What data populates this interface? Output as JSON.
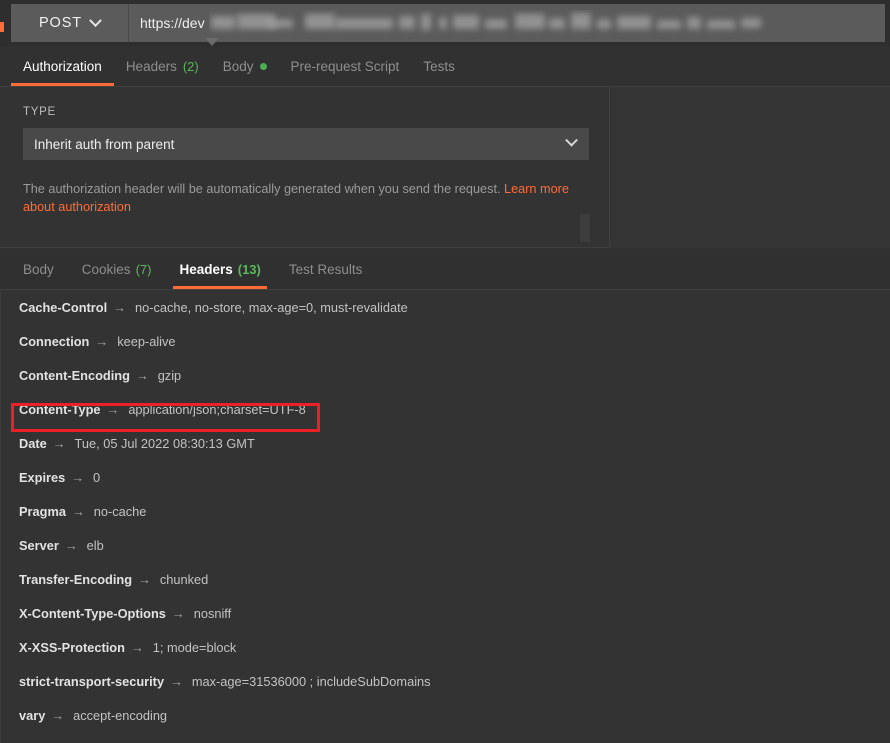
{
  "request": {
    "method": "POST",
    "url_visible_prefix": "https://dev",
    "url_redacted": true,
    "tabs": [
      {
        "label": "Authorization",
        "count": "",
        "active": true,
        "dot": false
      },
      {
        "label": "Headers",
        "count": "(2)",
        "active": false,
        "dot": false
      },
      {
        "label": "Body",
        "count": "",
        "active": false,
        "dot": true
      },
      {
        "label": "Pre-request Script",
        "count": "",
        "active": false,
        "dot": false
      },
      {
        "label": "Tests",
        "count": "",
        "active": false,
        "dot": false
      }
    ]
  },
  "authorization": {
    "type_label": "TYPE",
    "selected_type": "Inherit auth from parent",
    "note_text": "The authorization header will be automatically generated when you send the request. ",
    "note_link": "Learn more about authorization"
  },
  "response": {
    "tabs": [
      {
        "label": "Body",
        "count": "",
        "active": false
      },
      {
        "label": "Cookies",
        "count": "(7)",
        "active": false
      },
      {
        "label": "Headers",
        "count": "(13)",
        "active": true
      },
      {
        "label": "Test Results",
        "count": "",
        "active": false
      }
    ],
    "arrow_glyph": "→",
    "headers": [
      {
        "key": "Cache-Control",
        "value": "no-cache, no-store, max-age=0, must-revalidate",
        "highlighted": false
      },
      {
        "key": "Connection",
        "value": "keep-alive",
        "highlighted": false
      },
      {
        "key": "Content-Encoding",
        "value": "gzip",
        "highlighted": false
      },
      {
        "key": "Content-Type",
        "value": "application/json;charset=UTF-8",
        "highlighted": true
      },
      {
        "key": "Date",
        "value": "Tue, 05 Jul 2022 08:30:13 GMT",
        "highlighted": false
      },
      {
        "key": "Expires",
        "value": "0",
        "highlighted": false
      },
      {
        "key": "Pragma",
        "value": "no-cache",
        "highlighted": false
      },
      {
        "key": "Server",
        "value": "elb",
        "highlighted": false
      },
      {
        "key": "Transfer-Encoding",
        "value": "chunked",
        "highlighted": false
      },
      {
        "key": "X-Content-Type-Options",
        "value": "nosniff",
        "highlighted": false
      },
      {
        "key": "X-XSS-Protection",
        "value": "1; mode=block",
        "highlighted": false
      },
      {
        "key": "strict-transport-security",
        "value": "max-age=31536000 ; includeSubDomains",
        "highlighted": false
      },
      {
        "key": "vary",
        "value": "accept-encoding",
        "highlighted": false
      }
    ]
  },
  "annotation": {
    "target_header": "Content-Type",
    "color": "#ee2027"
  },
  "theme": {
    "accent": "#ff6c37",
    "count_green": "#5bb75b",
    "background": "#333333",
    "urlbar_background": "#2e2e2e",
    "field_background": "#5b5b5b"
  },
  "icons": {
    "method_chevron": "chevron-down-icon",
    "select_chevron": "chevron-down-icon",
    "body_modified": "green-dot-icon"
  }
}
